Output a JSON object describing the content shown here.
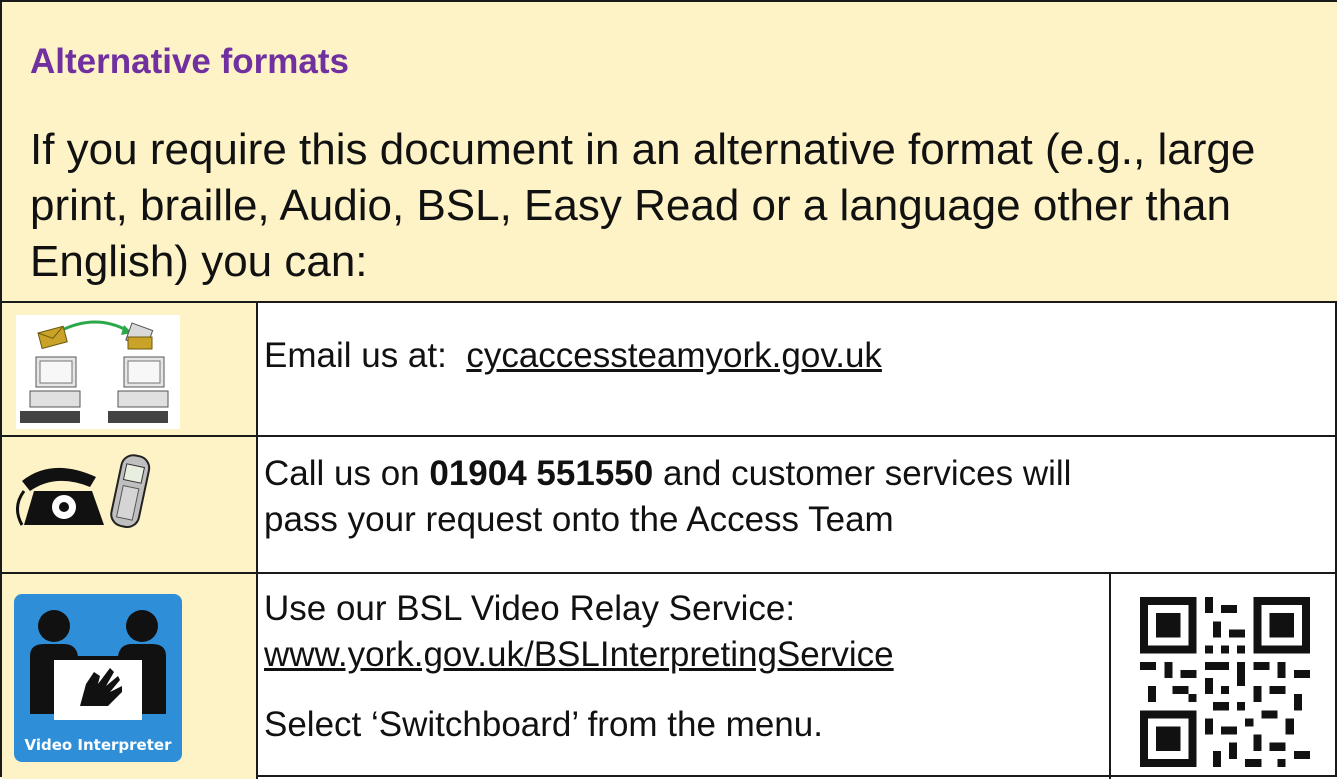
{
  "header": {
    "title": "Alternative formats"
  },
  "intro": {
    "text": "If you require this document in an alternative format (e.g., large print, braille, Audio, BSL, Easy Read or a language other than English) you can:"
  },
  "email": {
    "prefix": "Email us at:",
    "address": "cycaccessteamyork.gov.uk",
    "icon": "email-computers-icon"
  },
  "phone": {
    "prefix": "Call us on",
    "number": "01904 551550",
    "suffix": "and customer services will pass your request onto the Access Team",
    "icon": "telephone-icon"
  },
  "bsl": {
    "line1": "Use our BSL Video Relay Service:",
    "url": "www.york.gov.uk/BSLInterpretingService",
    "line3": "Select ‘Switchboard’ from the menu.",
    "icon_caption": "Video Interpreter",
    "icon": "video-interpreter-icon",
    "qr": "qr-code-icon"
  },
  "colors": {
    "heading": "#7030a0",
    "cream": "#fdf3c6",
    "icon_blue": "#2e8fd8"
  }
}
